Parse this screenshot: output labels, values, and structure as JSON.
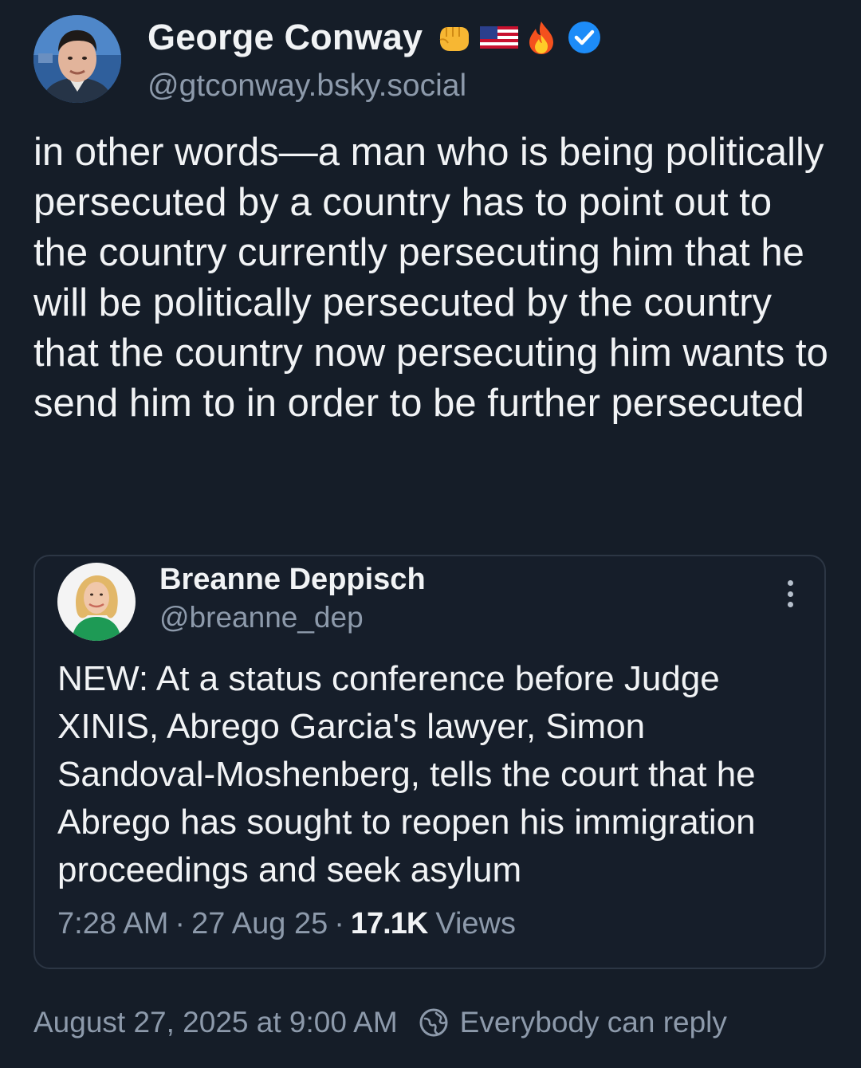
{
  "author": {
    "display_name": "George Conway",
    "emojis": [
      "fist-emoji",
      "us-flag-emoji",
      "fire-emoji"
    ],
    "verified_icon": "verified-check-icon",
    "handle": "@gtconway.bsky.social"
  },
  "post": {
    "text": "in other words—a man who is being politically persecuted by a country has to point out to the country currently persecuting him that he will be politically persecuted by the country that the country now persecuting him wants to send him to in order to be further persecuted"
  },
  "quote": {
    "display_name": "Breanne Deppisch",
    "handle": "@breanne_dep",
    "text": "NEW: At a status conference before Judge XINIS, Abrego Garcia's lawyer, Simon Sandoval-Moshenberg, tells the court that he Abrego has sought to reopen his immigration proceedings and seek asylum",
    "time": "7:28 AM",
    "separator": "·",
    "date": "27 Aug 25",
    "views_count": "17.1K",
    "views_label": "Views",
    "more_icon": "more-vertical-icon"
  },
  "footer": {
    "timestamp": "August 27, 2025 at 9:00 AM",
    "reply_setting": "Everybody can reply",
    "reply_icon": "globe-reply-icon"
  },
  "colors": {
    "background": "#151d28",
    "text_primary": "#f1f3f5",
    "text_secondary": "#8d9aab",
    "verified_blue": "#1d8cf8",
    "card_border": "#2c3644"
  }
}
